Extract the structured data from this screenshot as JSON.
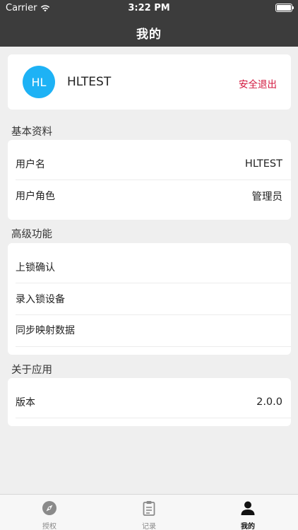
{
  "status": {
    "carrier": "Carrier",
    "time": "3:22 PM"
  },
  "nav": {
    "title": "我的"
  },
  "profile": {
    "avatar_initials": "HL",
    "username": "HLTEST",
    "logout_label": "安全退出",
    "avatar_color": "#1eb2f5",
    "logout_color": "#d2163c"
  },
  "basic": {
    "title": "基本资料",
    "rows": [
      {
        "label": "用户名",
        "value": "HLTEST"
      },
      {
        "label": "用户角色",
        "value": "管理员"
      }
    ]
  },
  "advanced": {
    "title": "高级功能",
    "items": [
      "上锁确认",
      "录入锁设备",
      "同步映射数据"
    ]
  },
  "about": {
    "title": "关于应用",
    "rows": [
      {
        "label": "版本",
        "value": "2.0.0"
      }
    ]
  },
  "tabs": [
    {
      "label": "授权",
      "icon": "compass-icon",
      "active": false
    },
    {
      "label": "记录",
      "icon": "clipboard-icon",
      "active": false
    },
    {
      "label": "我的",
      "icon": "person-icon",
      "active": true
    }
  ]
}
